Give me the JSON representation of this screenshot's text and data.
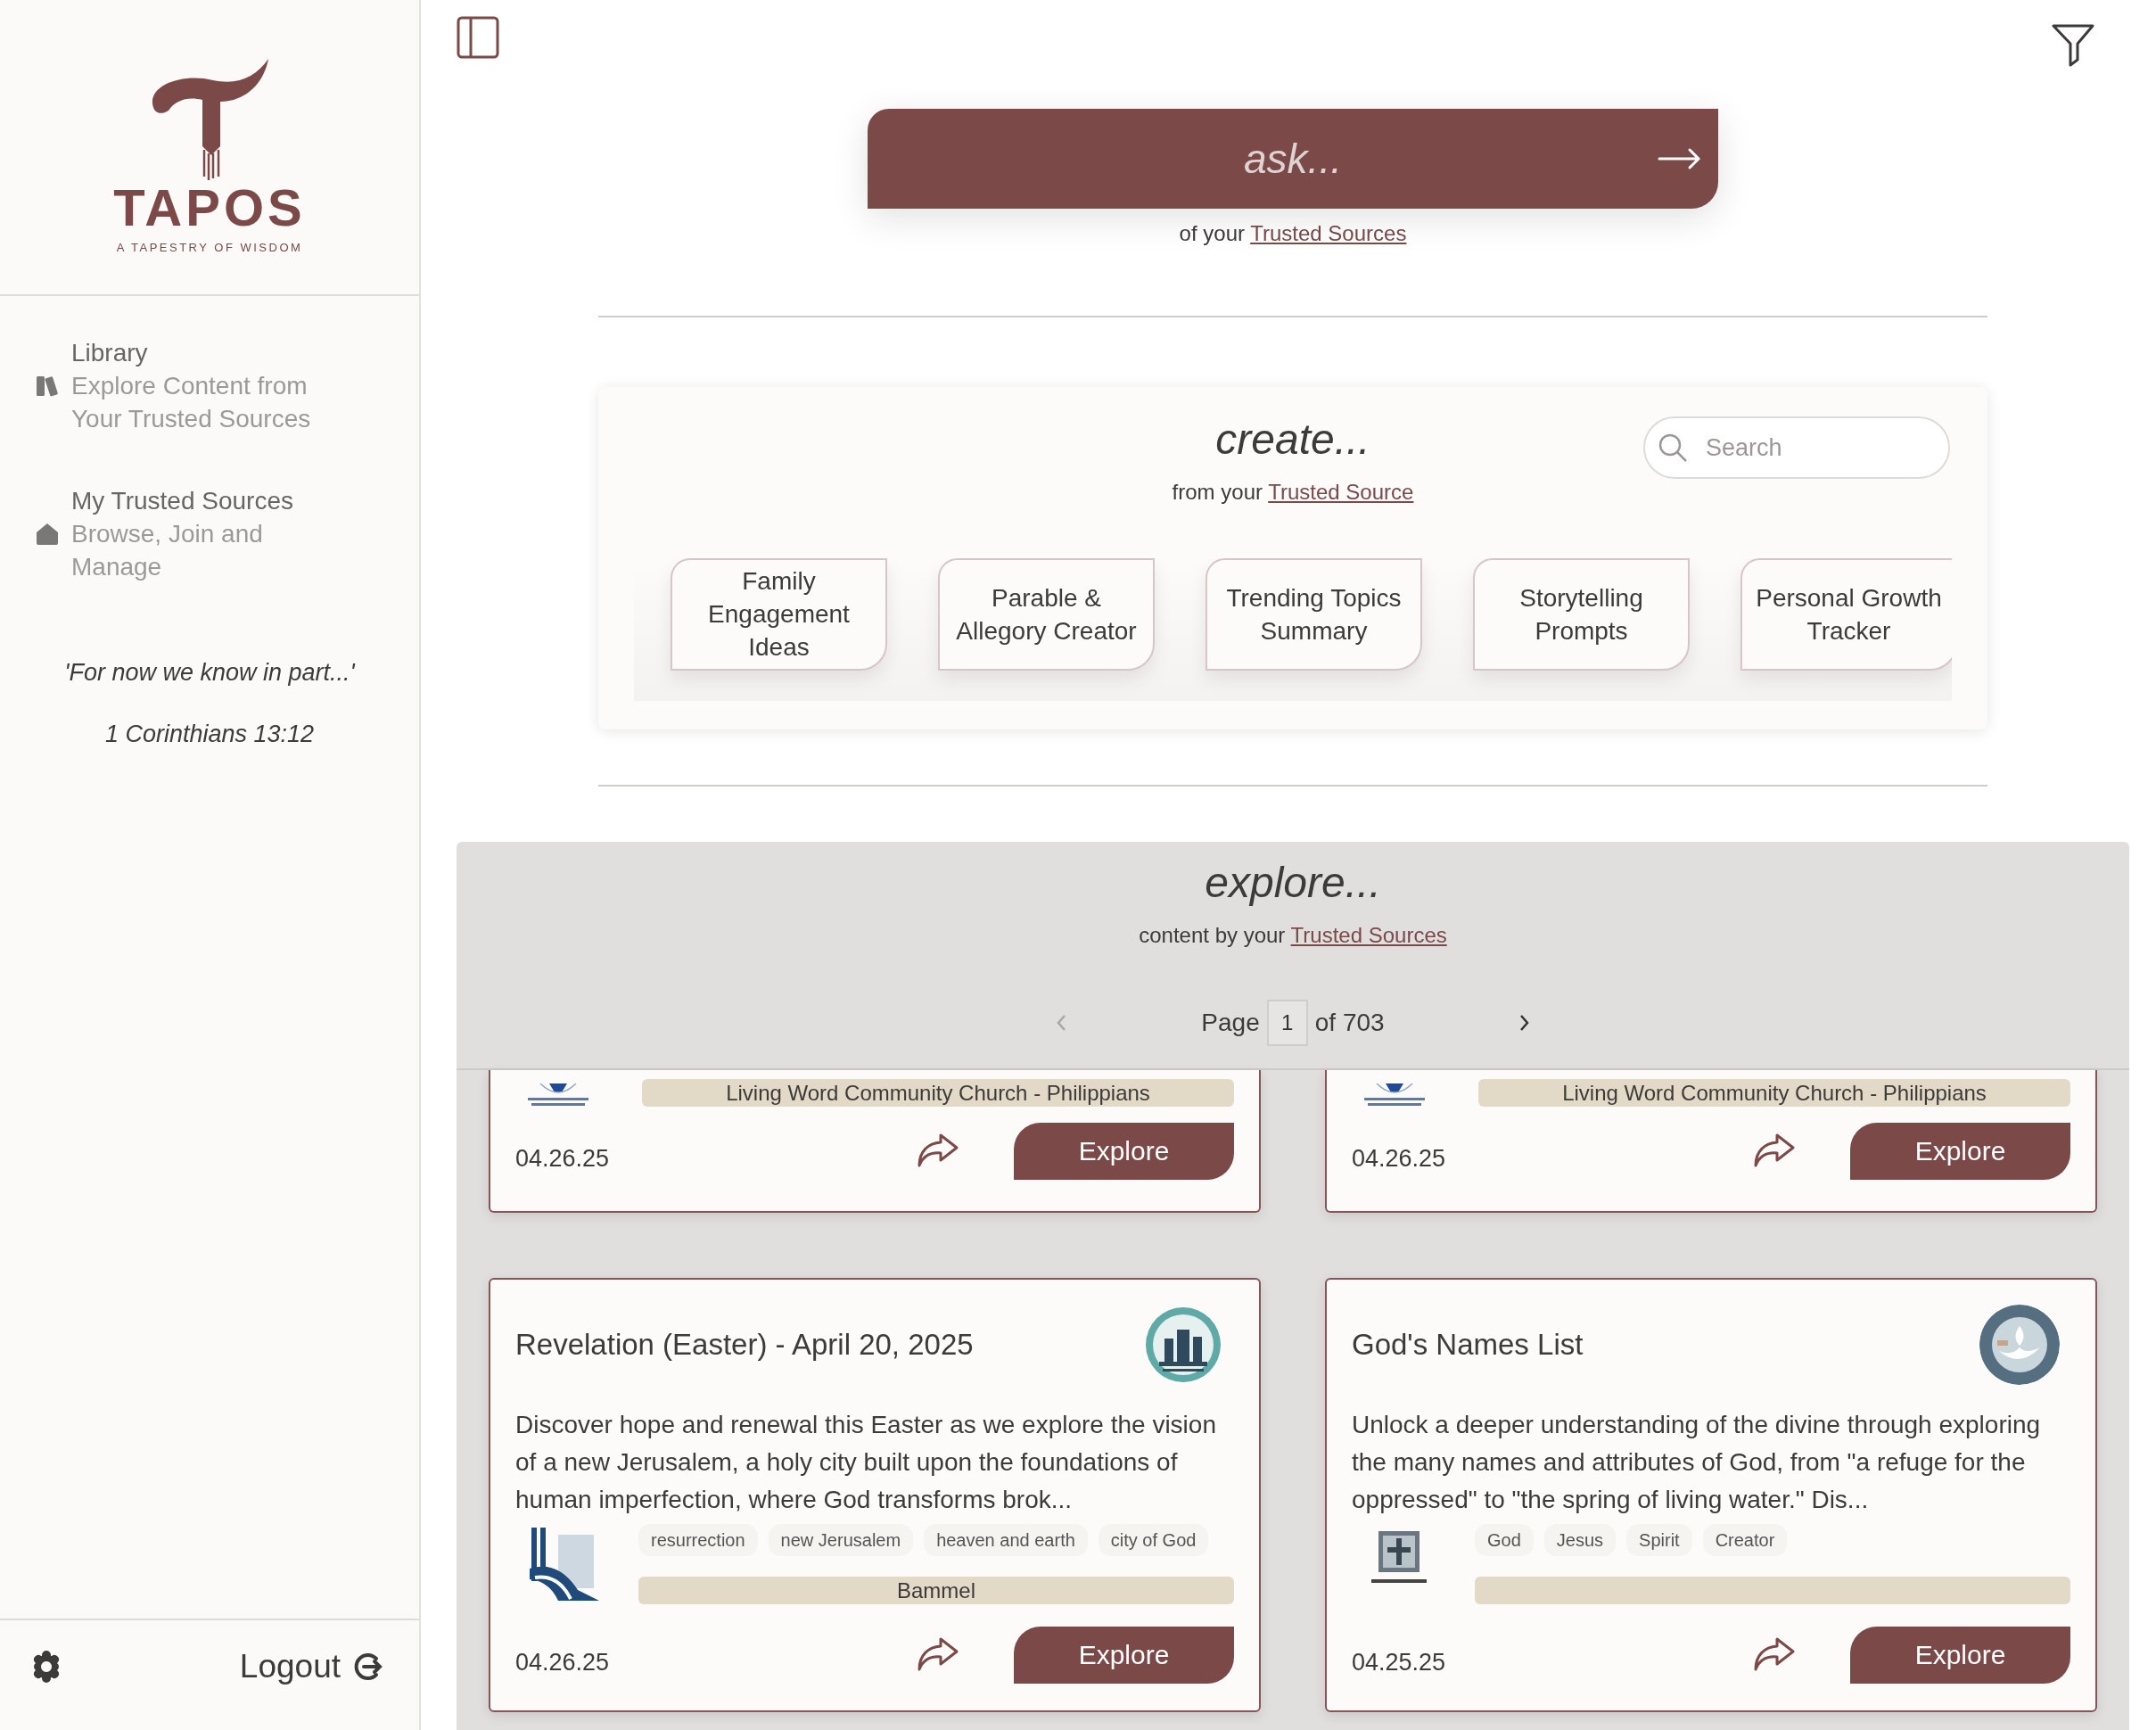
{
  "sidebar": {
    "logo": {
      "wordmark": "TAPOS",
      "tagline": "A TAPESTRY OF WISDOM"
    },
    "nav": [
      {
        "title": "Library",
        "subtitle": "Explore Content from Your Trusted Sources"
      },
      {
        "title": "My Trusted Sources",
        "subtitle": "Browse, Join and Manage"
      }
    ],
    "quote": "'For now we know in part...'",
    "reference": "1 Corinthians 13:12",
    "logout": "Logout"
  },
  "ask": {
    "placeholder": "ask...",
    "caption": "of your",
    "link": "Trusted Sources"
  },
  "create": {
    "title": "create...",
    "caption": "from your",
    "link": "Trusted Source",
    "search": {
      "placeholder": "Search"
    },
    "templates": [
      "Family Engagement Ideas",
      "Parable & Allegory Creator",
      "Trending Topics Summary",
      "Storytelling Prompts",
      "Personal Growth Tracker"
    ]
  },
  "explore": {
    "title": "explore...",
    "caption": "content by your",
    "link": "Trusted Sources",
    "pagination": {
      "label": "Page",
      "page": "1",
      "total": "of 703"
    },
    "cards": [
      {
        "kind": "partial",
        "source": "Living Word Community Church - Philippians",
        "date": "04.26.25",
        "button": "Explore"
      },
      {
        "kind": "partial",
        "source": "Living Word Community Church - Philippians",
        "date": "04.26.25",
        "button": "Explore"
      },
      {
        "kind": "full",
        "title": "Revelation (Easter) - April 20, 2025",
        "description": "Discover hope and renewal this Easter as we explore the vision of a new Jerusalem, a holy city built upon the foundations of human imperfection, where God transforms brok...",
        "tags": [
          "resurrection",
          "new Jerusalem",
          "heaven and earth",
          "city of God"
        ],
        "source": "Bammel",
        "date": "04.26.25",
        "button": "Explore"
      },
      {
        "kind": "full",
        "title": "God's Names List",
        "description": "Unlock a deeper understanding of the divine through exploring the many names and attributes of God, from \"a refuge for the oppressed\" to \"the spring of living water.\" Dis...",
        "tags": [
          "God",
          "Jesus",
          "Spirit",
          "Creator"
        ],
        "date": "04.25.25",
        "button": "Explore"
      }
    ]
  }
}
